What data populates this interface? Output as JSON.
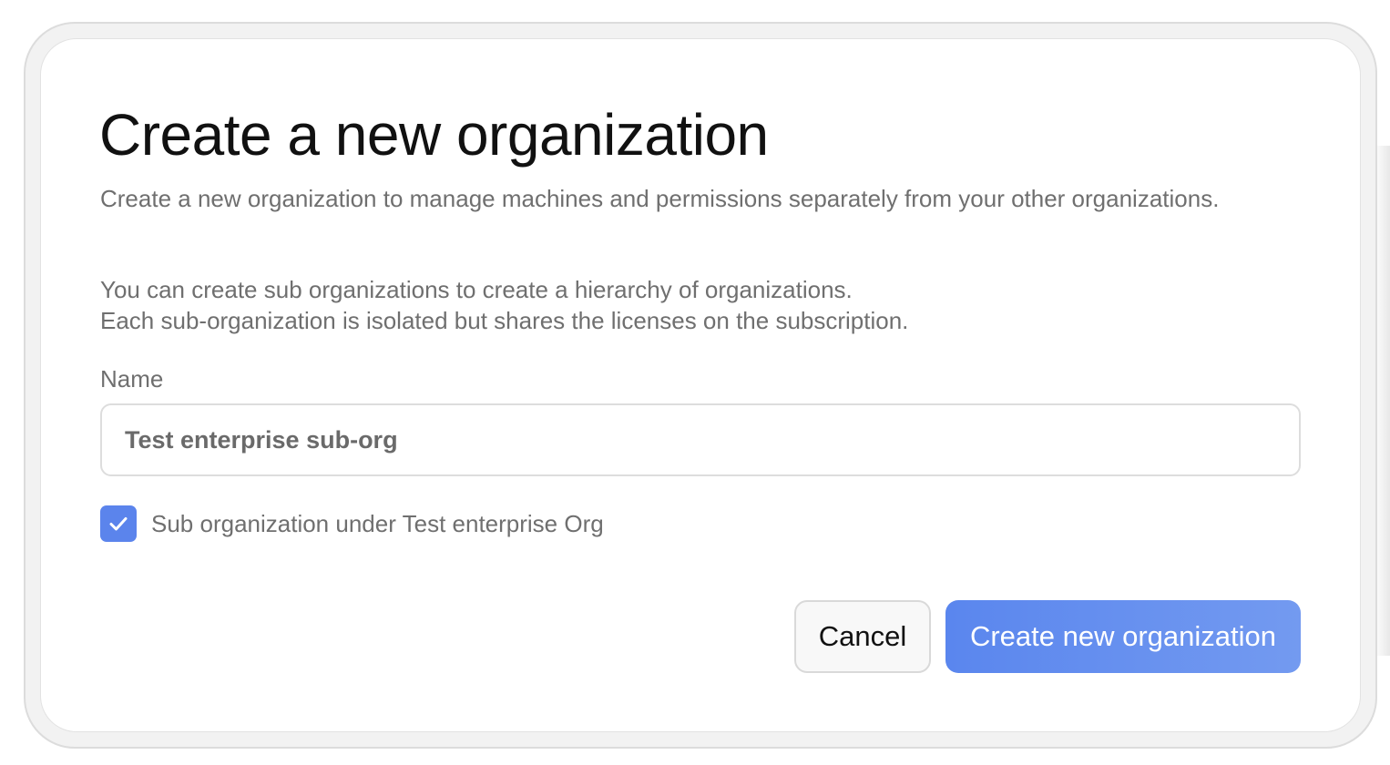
{
  "dialog": {
    "title": "Create a new organization",
    "description": "Create a new organization to manage machines and permissions separately from your other organizations.",
    "info_line_1": "You can create sub organizations to create a hierarchy of organizations.",
    "info_line_2": "Each sub-organization is isolated but shares the licenses on the subscription."
  },
  "form": {
    "name_label": "Name",
    "name_value": "Test enterprise sub-org",
    "sub_org_checkbox_label": "Sub organization under Test enterprise Org",
    "sub_org_checked": true
  },
  "actions": {
    "cancel_label": "Cancel",
    "create_label": "Create new organization"
  },
  "colors": {
    "accent": "#5b84ec",
    "title_text": "#111111",
    "muted_text": "#6f6f6f"
  },
  "icons": {
    "checkbox_check": "check-icon"
  }
}
